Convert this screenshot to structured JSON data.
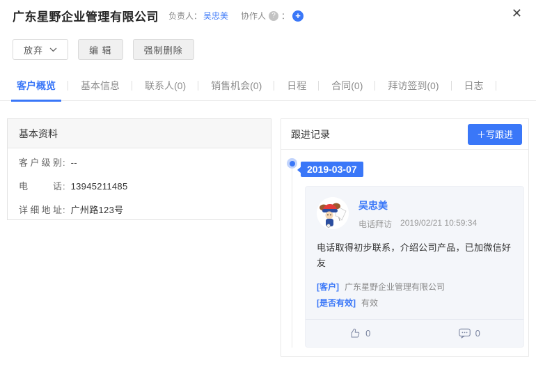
{
  "accent_color": "#3a77f8",
  "header": {
    "title": "广东星野企业管理有限公司",
    "owner_label": "负责人：",
    "owner_name": "吴忠美",
    "collaborator_label": "协作人",
    "help_glyph": "?",
    "colon": "：",
    "plus_glyph": "+",
    "close_glyph": "✕"
  },
  "toolbar": {
    "abandon_label": "放弃",
    "edit_label": "编 辑",
    "force_delete_label": "强制删除"
  },
  "tabs": {
    "items": [
      {
        "label": "客户概览",
        "active": true
      },
      {
        "label": "基本信息",
        "active": false
      },
      {
        "label": "联系人(0)",
        "active": false
      },
      {
        "label": "销售机会(0)",
        "active": false
      },
      {
        "label": "日程",
        "active": false
      },
      {
        "label": "合同(0)",
        "active": false
      },
      {
        "label": "拜访签到(0)",
        "active": false
      },
      {
        "label": "日志",
        "active": false
      }
    ]
  },
  "left_panel": {
    "title": "基本资料",
    "colon": ":",
    "fields": [
      {
        "label": "客户级别",
        "value": "--"
      },
      {
        "label": "电话",
        "value": "13945211485"
      },
      {
        "label": "详细地址",
        "value": "广州路123号"
      }
    ]
  },
  "right_panel": {
    "title": "跟进记录",
    "add_followup_label": "＋写跟进",
    "timeline": {
      "date": "2019-03-07",
      "entry": {
        "author": "吴忠美",
        "type": "电话拜访",
        "timestamp": "2019/02/21 10:59:34",
        "content": "电话取得初步联系，介绍公司产品，已加微信好友",
        "fields": [
          {
            "label": "[客户]",
            "value": "广东星野企业管理有限公司"
          },
          {
            "label": "[是否有效]",
            "value": "有效"
          }
        ],
        "like_count": "0",
        "comment_count": "0"
      }
    }
  }
}
